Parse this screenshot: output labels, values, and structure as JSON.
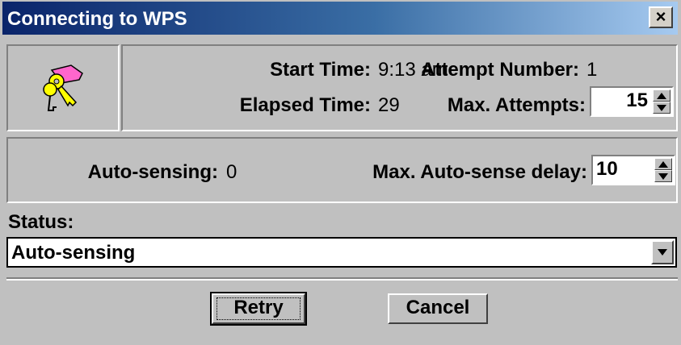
{
  "window": {
    "title": "Connecting to WPS",
    "close_glyph": "×"
  },
  "icon": {
    "name": "keys-icon"
  },
  "connection": {
    "start_time_label": "Start Time:",
    "start_time_value": "9:13 am",
    "elapsed_time_label": "Elapsed Time:",
    "elapsed_time_value": "29",
    "attempt_number_label": "Attempt Number:",
    "attempt_number_value": "1",
    "max_attempts_label": "Max. Attempts:",
    "max_attempts_value": "15"
  },
  "autosense": {
    "autosensing_label": "Auto-sensing:",
    "autosensing_value": "0",
    "max_delay_label": "Max. Auto-sense delay:",
    "max_delay_value": "10"
  },
  "status": {
    "label": "Status:",
    "value": "Auto-sensing"
  },
  "buttons": {
    "retry": "Retry",
    "cancel": "Cancel"
  },
  "colors": {
    "face": "#c0c0c0",
    "title_start": "#0a246a",
    "title_end": "#a6caf0",
    "key_pink": "#ff66cc",
    "key_yellow": "#ffff00"
  }
}
